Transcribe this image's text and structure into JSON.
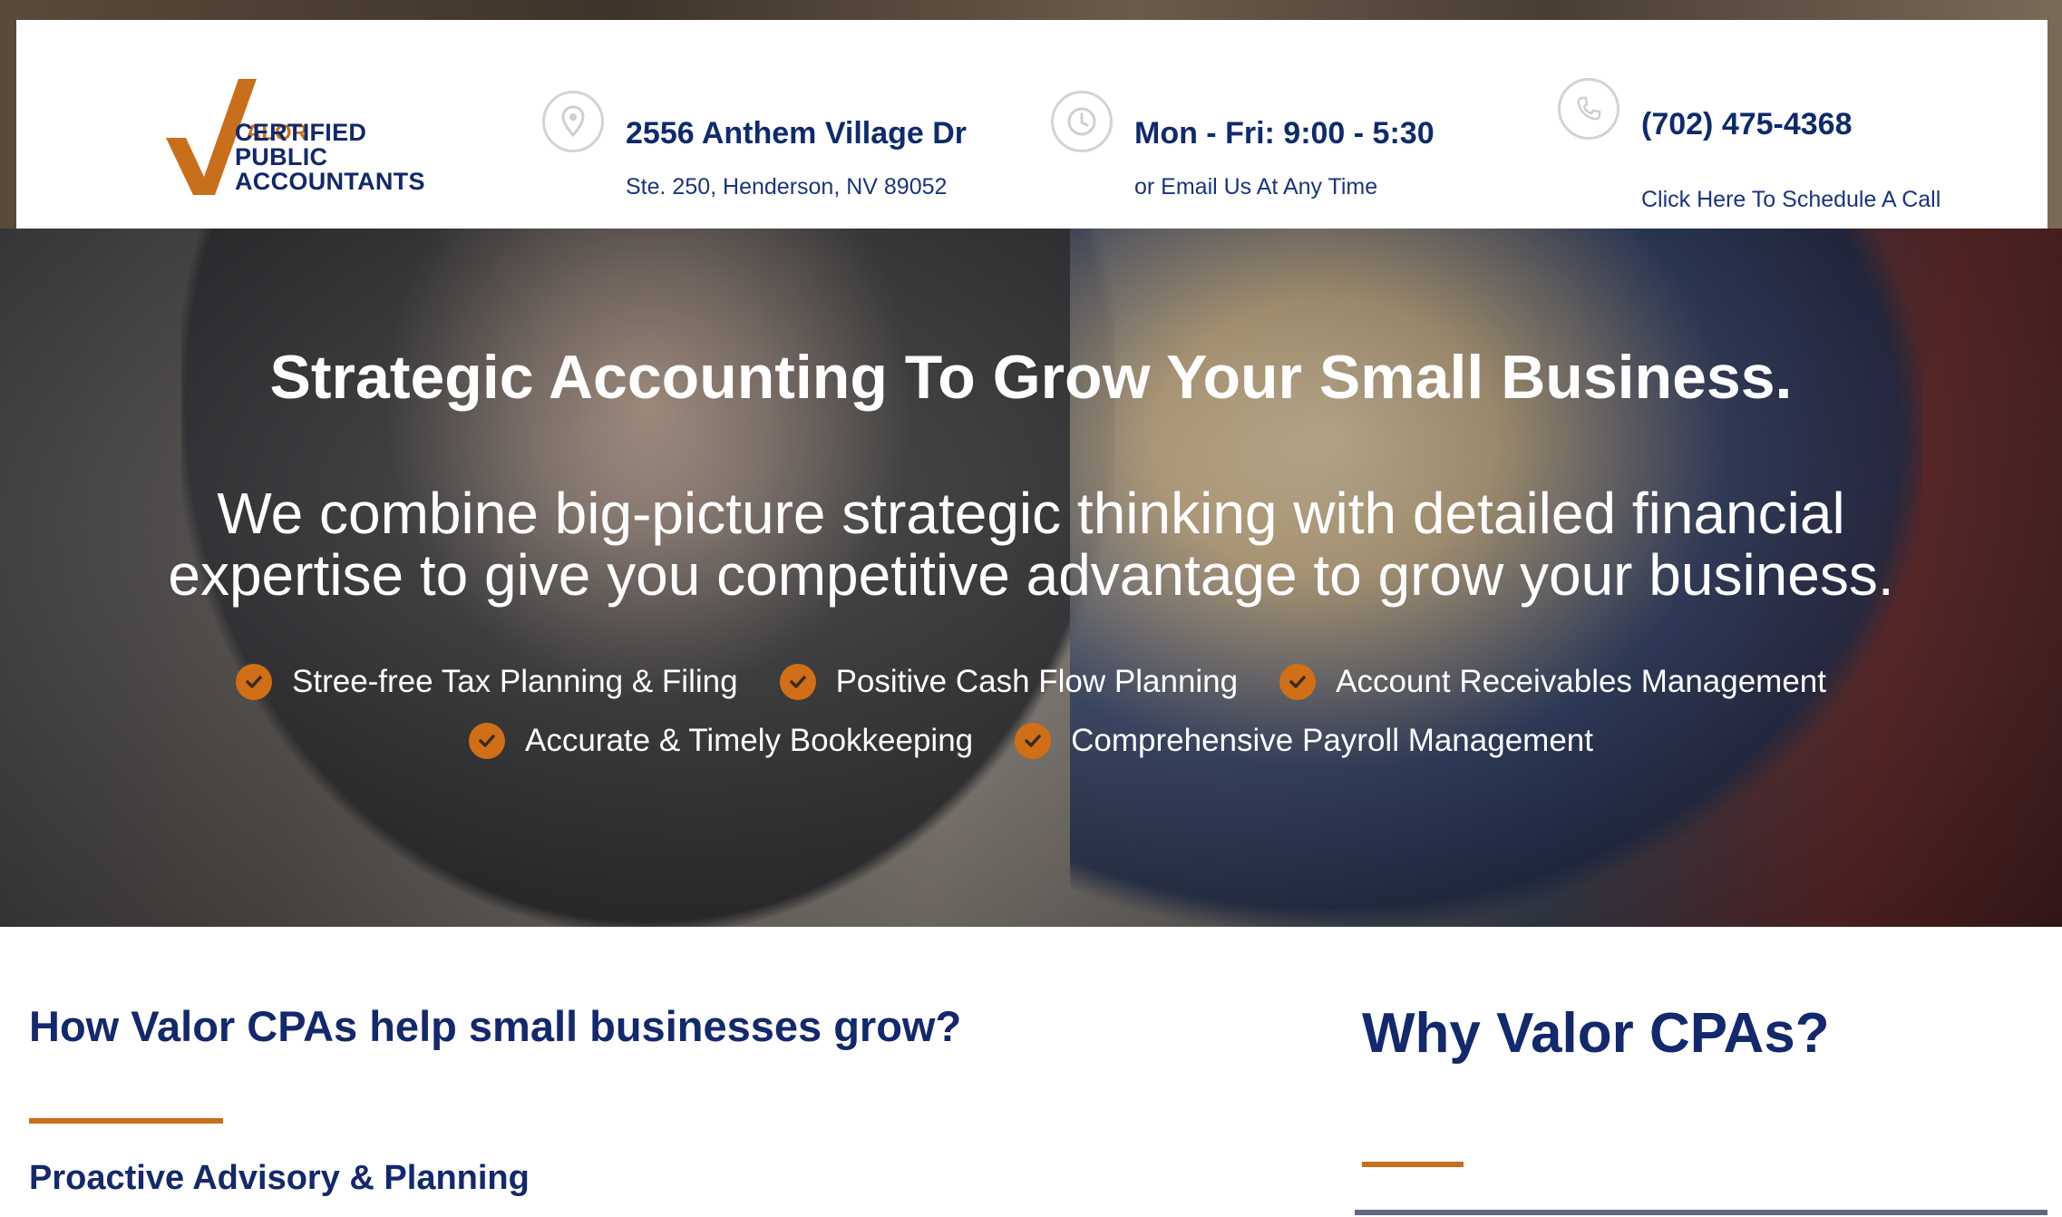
{
  "header": {
    "logo": {
      "brand": "ALOR",
      "lines": [
        "CERTIFIED",
        "PUBLIC",
        "ACCOUNTANTS"
      ]
    },
    "address": {
      "icon": "map-pin-icon",
      "title": "2556 Anthem Village Dr",
      "subtitle": "Ste. 250, Henderson, NV 89052"
    },
    "hours": {
      "icon": "clock-icon",
      "title": "Mon - Fri: 9:00 - 5:30",
      "subtitle": "or Email Us At Any Time"
    },
    "phone": {
      "icon": "phone-icon",
      "title": "(702) 475-4368",
      "link": "Click Here To Schedule A Call"
    }
  },
  "hero": {
    "title": "Strategic Accounting To Grow Your Small Business.",
    "description": "We combine big-picture strategic thinking with detailed financial expertise to give you competitive advantage to grow your business.",
    "features_row1": [
      "Stree-free Tax Planning & Filing",
      "Positive Cash Flow Planning",
      "Account Receivables Management"
    ],
    "features_row2": [
      "Accurate & Timely Bookkeeping",
      "Comprehensive Payroll Management"
    ]
  },
  "main": {
    "left_title": "How Valor CPAs help small businesses grow?",
    "left_subheading": "Proactive Advisory & Planning",
    "right_title": "Why Valor CPAs?"
  },
  "colors": {
    "brand_navy": "#13286d",
    "accent_orange": "#c96f1c",
    "check_orange": "#d06f17"
  }
}
